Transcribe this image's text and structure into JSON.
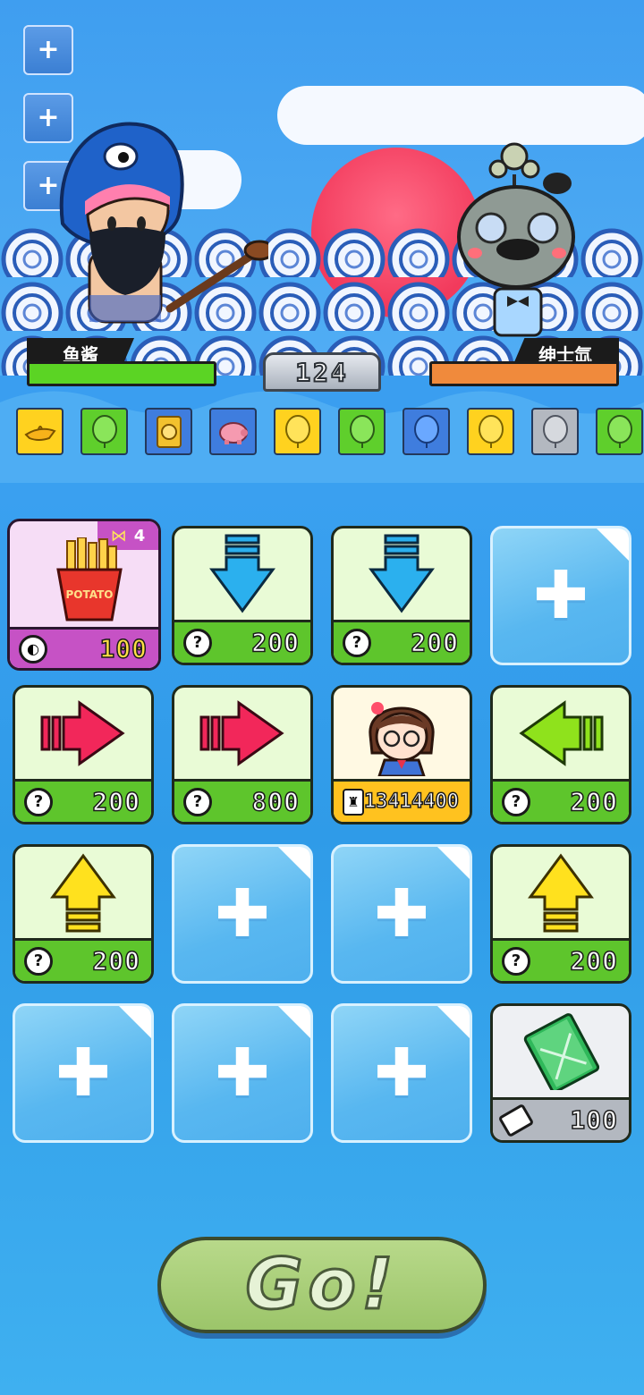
{
  "hud": {
    "player_name": "鱼酱",
    "enemy_name": "绅士氙",
    "turn_counter": "124",
    "player_hp_color": "#5bd424",
    "enemy_hp_color": "#f08a3c"
  },
  "side_buttons": [
    {
      "icon": "plus-icon",
      "label": "+"
    },
    {
      "icon": "plus-icon",
      "label": "+"
    },
    {
      "icon": "plus-icon",
      "label": "+"
    }
  ],
  "inventory": [
    {
      "icon": "magic-lamp-icon",
      "bg": "#ffd21f"
    },
    {
      "icon": "green-balloon-icon",
      "bg": "#5fcf2c"
    },
    {
      "icon": "golden-frame-icon",
      "bg": "#3f7dde"
    },
    {
      "icon": "piggy-bank-icon",
      "bg": "#3f7dde"
    },
    {
      "icon": "yellow-balloon-icon",
      "bg": "#ffd21f"
    },
    {
      "icon": "green-balloon-icon",
      "bg": "#5fcf2c"
    },
    {
      "icon": "blue-balloon-icon",
      "bg": "#3f7dde"
    },
    {
      "icon": "yellow-balloon-icon",
      "bg": "#ffd21f"
    },
    {
      "icon": "grey-balloon-icon",
      "bg": "#b3b8c0"
    },
    {
      "icon": "green-balloon-icon",
      "bg": "#5fcf2c"
    }
  ],
  "cards": {
    "fries": {
      "badge": "4",
      "price": "100",
      "icon": "french-fries-icon"
    },
    "c2": {
      "price": "200",
      "icon": "arrow-down-icon"
    },
    "c3": {
      "price": "200",
      "icon": "arrow-down-icon"
    },
    "c5": {
      "price": "200",
      "icon": "arrow-right-icon"
    },
    "c6": {
      "price": "800",
      "icon": "arrow-right-icon"
    },
    "c7": {
      "price": "13414400",
      "icon": "girl-avatar-icon"
    },
    "c8": {
      "price": "200",
      "icon": "arrow-left-icon"
    },
    "c9": {
      "price": "200",
      "icon": "arrow-up-icon"
    },
    "c12": {
      "price": "200",
      "icon": "arrow-up-icon"
    },
    "c16": {
      "price": "100",
      "icon": "chemistry-book-icon"
    }
  },
  "go_button": {
    "label": "Go!"
  }
}
